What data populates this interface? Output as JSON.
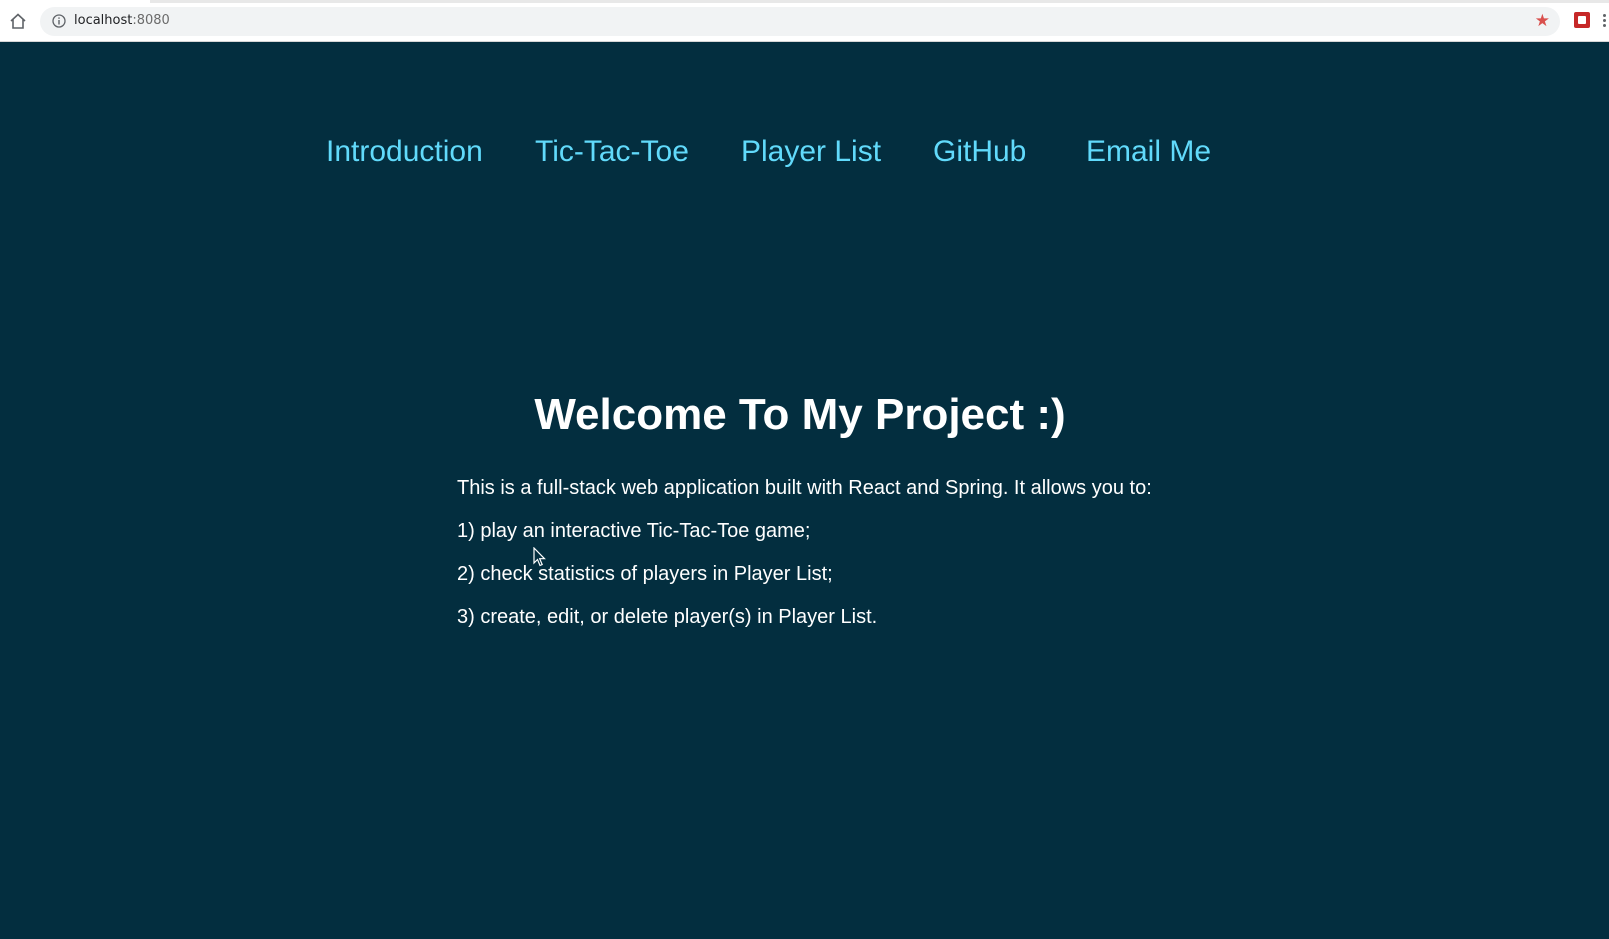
{
  "browser": {
    "url_host": "localhost",
    "url_port": ":8080",
    "home_icon": "home-icon",
    "info_icon": "info-icon",
    "bookmark_icon": "star-icon",
    "bookmark_color": "#d9504d"
  },
  "nav": {
    "items": [
      {
        "label": "Introduction"
      },
      {
        "label": "Tic-Tac-Toe"
      },
      {
        "label": "Player List"
      },
      {
        "label": "GitHub"
      },
      {
        "label": "Email Me"
      }
    ],
    "link_color": "#61dafb"
  },
  "main": {
    "title": "Welcome To My Project :)",
    "paragraphs": [
      "This is a full-stack web application built with React and Spring. It allows you to:",
      "1) play an interactive Tic-Tac-Toe game;",
      "2) check statistics of players in Player List;",
      "3) create, edit, or delete player(s) in Player List."
    ]
  },
  "theme": {
    "background": "#032e3f",
    "text": "#ffffff"
  }
}
